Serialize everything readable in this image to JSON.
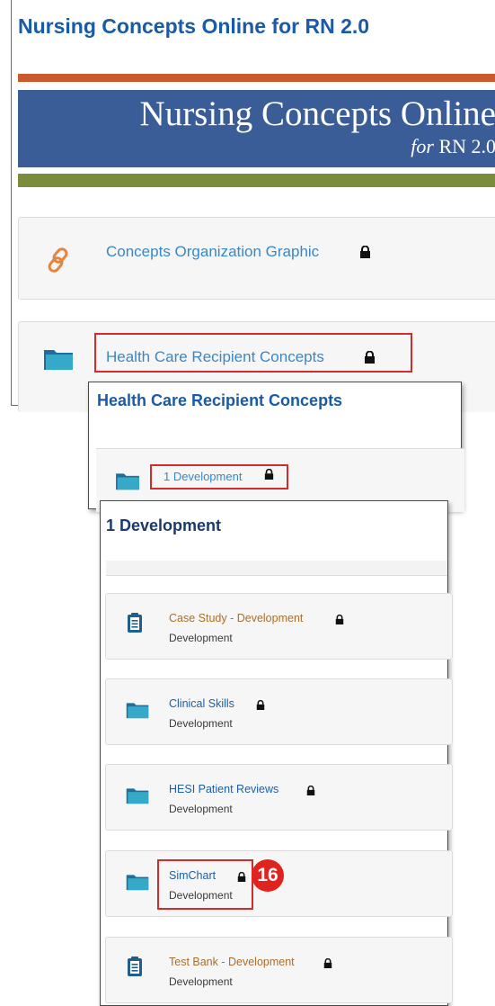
{
  "panel_main": {
    "title": "Nursing Concepts Online for RN 2.0",
    "banner": {
      "title": "Nursing Concepts Online",
      "sub_prefix": "for",
      "sub_rest": "RN 2.0"
    },
    "items": [
      {
        "label": "Concepts Organization Graphic",
        "icon": "link-icon",
        "locked": true
      },
      {
        "label": "Health Care Recipient Concepts",
        "icon": "folder-icon",
        "locked": true,
        "highlighted": true
      }
    ]
  },
  "panel_hcr": {
    "title": "Health Care Recipient Concepts",
    "items": [
      {
        "label": "1 Development",
        "icon": "folder-icon",
        "locked": true,
        "highlighted": true
      }
    ]
  },
  "panel_dev": {
    "title": "1 Development",
    "items": [
      {
        "label": "Case Study - Development",
        "sub": "Development",
        "icon": "clipboard-icon",
        "locked": true
      },
      {
        "label": "Clinical Skills",
        "sub": "Development",
        "icon": "folder-icon",
        "locked": true
      },
      {
        "label": "HESI Patient Reviews",
        "sub": "Development",
        "icon": "folder-icon",
        "locked": true
      },
      {
        "label": "SimChart",
        "sub": "Development",
        "icon": "folder-icon",
        "locked": true,
        "highlighted": true
      },
      {
        "label": "Test Bank - Development",
        "sub": "Development",
        "icon": "clipboard-icon",
        "locked": true
      }
    ]
  },
  "callout": {
    "number": "16"
  },
  "colors": {
    "heading_blue": "#1a5aa6",
    "link_blue": "#3a87c7",
    "orange_link": "#a86f2a",
    "banner_blue": "#3b5d97",
    "orange_bar": "#c85a2c",
    "green_bar": "#7b8c3b",
    "highlight_red": "#d22b2b",
    "folder_teal": "#2b8fb0"
  }
}
